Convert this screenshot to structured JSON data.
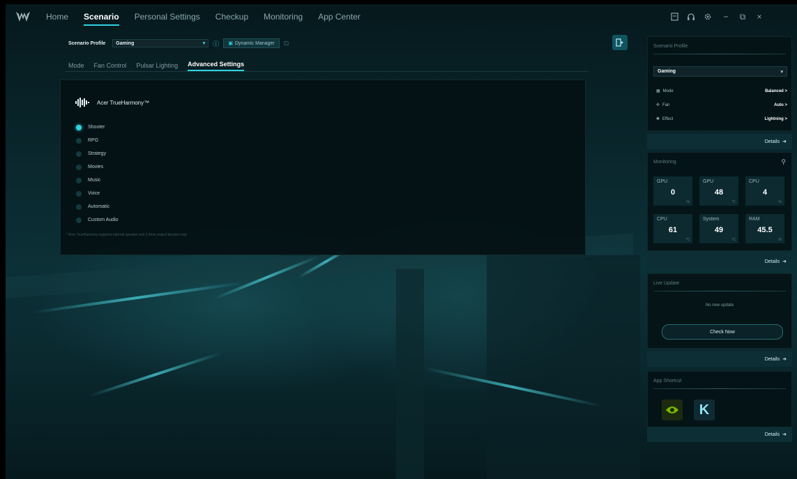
{
  "nav": {
    "items": [
      "Home",
      "Scenario",
      "Personal Settings",
      "Checkup",
      "Monitoring",
      "App Center"
    ],
    "active": "Scenario"
  },
  "window_controls": {
    "minimize": "−",
    "restore": "⧉",
    "close": "×"
  },
  "profile_bar": {
    "label": "Scenario Profile",
    "value": "Gaming",
    "dropdown_icon": "chevron-down-icon",
    "dm_label": "Dynamic Manager"
  },
  "subtabs": [
    "Mode",
    "Fan Control",
    "Pulsar Lighting",
    "Advanced Settings"
  ],
  "active_subtab": "Advanced Settings",
  "true_harmony": {
    "title": "Acer TrueHarmony™",
    "options": [
      "Shooter",
      "RPG",
      "Strategy",
      "Movies",
      "Music",
      "Voice",
      "Automatic",
      "Custom Audio"
    ],
    "selected": "Shooter",
    "footnote": "* Acer TrueHarmony supports internal speaker and 3.5mm output devices only"
  },
  "sidebar": {
    "scenario_profile": {
      "title": "Scenario Profile",
      "value": "Gaming",
      "rows": [
        {
          "key": "Mode",
          "value": "Balanced >"
        },
        {
          "key": "Fan",
          "value": "Auto >"
        },
        {
          "key": "Effect",
          "value": "Lightning >"
        }
      ],
      "details": "Details"
    },
    "monitoring": {
      "title": "Monitoring",
      "tiles": [
        {
          "label": "GPU",
          "value": "0",
          "unit": "%"
        },
        {
          "label": "GPU",
          "value": "48",
          "unit": "°C"
        },
        {
          "label": "CPU",
          "value": "4",
          "unit": "%"
        },
        {
          "label": "CPU",
          "value": "61",
          "unit": "°C"
        },
        {
          "label": "System",
          "value": "49",
          "unit": "°C"
        },
        {
          "label": "RAM",
          "value": "45.5",
          "unit": "%"
        }
      ],
      "details": "Details"
    },
    "live_update": {
      "title": "Live Update",
      "message": "No new update",
      "button": "Check Now",
      "details": "Details"
    },
    "app_shortcut": {
      "title": "App Shortcut",
      "apps": [
        "nvidia-icon",
        "killer-icon"
      ],
      "k_letter": "K",
      "details": "Details"
    }
  },
  "colors": {
    "accent": "#2fd3e0",
    "panel": "#04121a",
    "details_bar": "#0d2e34",
    "warning": "#b3242c"
  }
}
